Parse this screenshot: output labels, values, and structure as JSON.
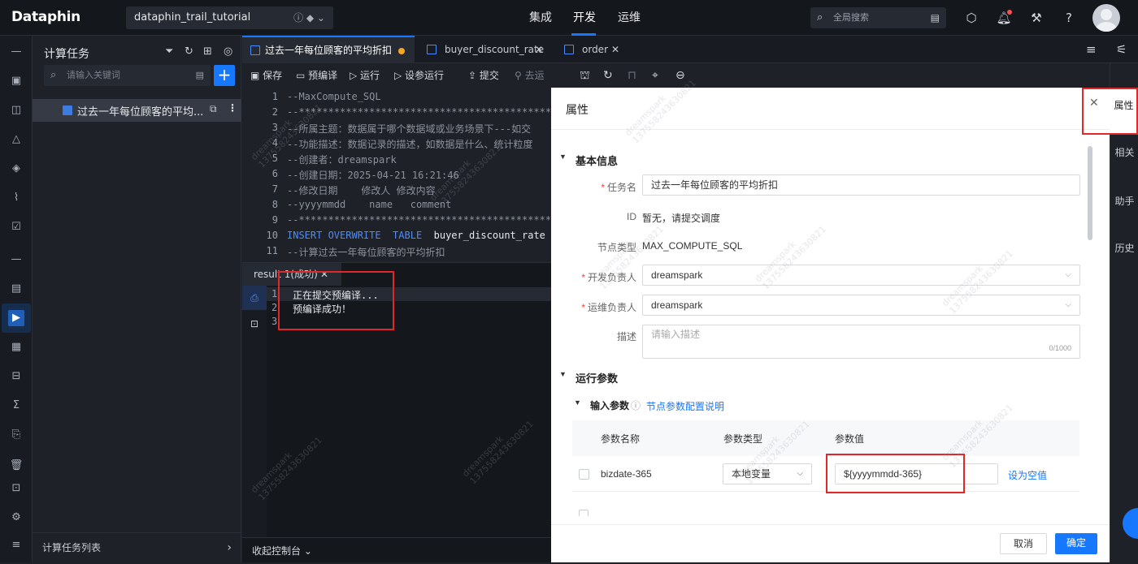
{
  "topbar": {
    "logo": "Dataphin",
    "project_name": "dataphin_trail_tutorial",
    "nav": [
      "集成",
      "开发",
      "运维"
    ],
    "active_nav": "开发",
    "search_placeholder": "全局搜索"
  },
  "sidebar": {
    "title": "计算任务",
    "search_placeholder": "请输入关键词",
    "tree_item_label": "过去一年每位顾客的平均...",
    "footer_label": "计算任务列表"
  },
  "tabs": [
    {
      "label": "过去一年每位顾客的平均折扣",
      "active": true,
      "modified": true
    },
    {
      "label": "buyer_discount_rate",
      "active": false
    },
    {
      "label": "order",
      "active": false
    }
  ],
  "toolbar": {
    "save": "保存",
    "precompile": "预编译",
    "run": "运行",
    "run_with_params": "设参运行",
    "submit": "提交",
    "to_ops": "去运维"
  },
  "editor": {
    "lines": [
      {
        "n": "1",
        "text": "--MaxCompute_SQL"
      },
      {
        "n": "2",
        "text": "--**********************************************"
      },
      {
        "n": "3",
        "text": "--所属主题：数据属于哪个数据域或业务场景下---如交"
      },
      {
        "n": "4",
        "text": "--功能描述：数据记录的描述，如数据是什么、统计粒度"
      },
      {
        "n": "5",
        "text": "--创建者：dreamspark"
      },
      {
        "n": "6",
        "text": "--创建日期：2025-04-21 16:21:46"
      },
      {
        "n": "7",
        "text": "--修改日期    修改人 修改内容"
      },
      {
        "n": "8",
        "text": "--yyyymmdd    name   comment"
      },
      {
        "n": "9",
        "text": "--**********************************************"
      },
      {
        "n": "10",
        "kw1": "INSERT OVERWRITE",
        "kw2": "TABLE",
        "ident": "buyer_discount_rate"
      },
      {
        "n": "11",
        "text": "--计算过去一年每位顾客的平均折扣"
      }
    ]
  },
  "result": {
    "tab_label": "result 1(成功)",
    "line_numbers": [
      "1",
      "2",
      "3"
    ],
    "lines": [
      "正在提交预编译...",
      "预编译成功！"
    ],
    "collapse_label": "收起控制台"
  },
  "props": {
    "title": "属性",
    "section_basic": "基本信息",
    "fields": {
      "task_name_label": "任务名",
      "task_name_value": "过去一年每位顾客的平均折扣",
      "id_label": "ID",
      "id_value": "暂无，请提交调度",
      "node_type_label": "节点类型",
      "node_type_value": "MAX_COMPUTE_SQL",
      "dev_owner_label": "开发负责人",
      "dev_owner_value": "dreamspark",
      "ops_owner_label": "运维负责人",
      "ops_owner_value": "dreamspark",
      "desc_label": "描述",
      "desc_placeholder": "请输入描述",
      "desc_count": "0/1000"
    },
    "section_run": "运行参数",
    "input_params_label": "输入参数",
    "input_params_help": "节点参数配置说明",
    "table": {
      "headers": [
        "参数名称",
        "参数类型",
        "参数值"
      ],
      "row": {
        "name": "bizdate-365",
        "type": "本地变量",
        "value": "${yyyymmdd-365}",
        "action": "设为空值"
      }
    },
    "cancel": "取消",
    "confirm": "确定"
  },
  "right_tabs": [
    "属性",
    "相关",
    "助手",
    "历史"
  ],
  "watermark": [
    "dreamspark",
    "13755824363​0821"
  ],
  "colors": {
    "accent": "#1677ff",
    "highlight": "#e02828",
    "dark_bg": "#1e2128"
  }
}
